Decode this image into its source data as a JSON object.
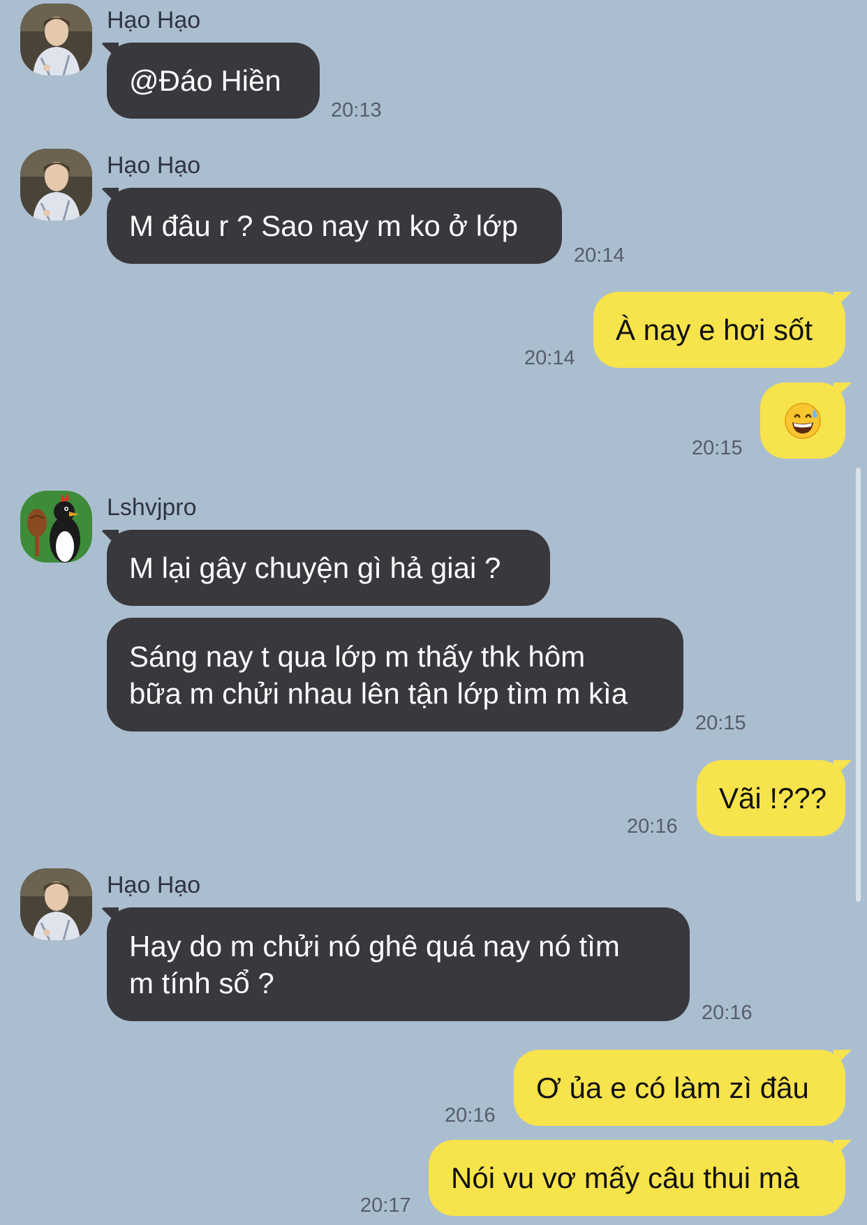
{
  "users": {
    "hao": "Hạo Hạo",
    "lsh": "Lshvjpro"
  },
  "messages": [
    {
      "text": "@Đáo Hiền",
      "time": "20:13"
    },
    {
      "text": "M đâu r ? Sao nay m ko ở lớp",
      "time": "20:14"
    },
    {
      "text": "À nay e hơi sốt",
      "time": "20:14"
    },
    {
      "emoji": "grinning-face-with-sweat",
      "time": "20:15"
    },
    {
      "text": "M lại gây chuyện gì hả giai ?"
    },
    {
      "lines": [
        "Sáng nay t qua lớp m thấy thk hôm",
        "bữa m chửi nhau lên tận lớp tìm m kìa"
      ],
      "time": "20:15"
    },
    {
      "text": "Vãi !???",
      "time": "20:16"
    },
    {
      "lines": [
        "Hay do m chửi nó ghê quá nay nó tìm",
        "m tính sổ ?"
      ],
      "time": "20:16"
    },
    {
      "text": "Ơ ủa e có làm zì đâu",
      "time": "20:16"
    },
    {
      "text": "Nói vu vơ mấy câu thui mà",
      "time": "20:17"
    }
  ],
  "colors": {
    "background": "#abbed0",
    "incoming_bubble": "#38383d",
    "outgoing_bubble": "#f7e34b"
  }
}
